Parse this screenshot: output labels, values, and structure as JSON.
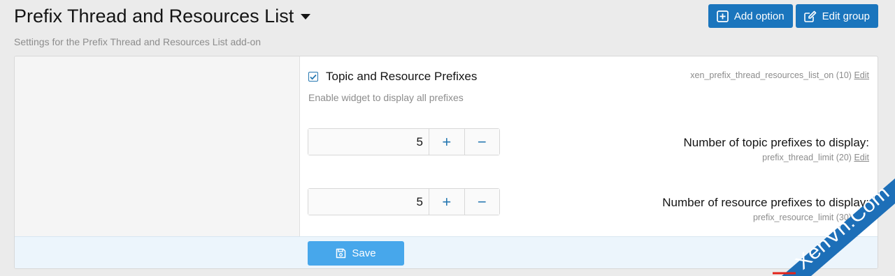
{
  "header": {
    "title": "Prefix Thread and Resources List",
    "description": "Settings for the Prefix Thread and Resources List add-on",
    "add_option_label": "Add option",
    "edit_group_label": "Edit group"
  },
  "options": {
    "toggle": {
      "code": "xen_prefix_thread_resources_list_on (10)",
      "edit_label": "Edit",
      "checkbox_label": "Topic and Resource Prefixes",
      "checked": true,
      "hint": "Enable widget to display all prefixes"
    },
    "thread_limit": {
      "label": "Number of topic prefixes to display:",
      "code": "prefix_thread_limit (20)",
      "edit_label": "Edit",
      "value": "5"
    },
    "resource_limit": {
      "label": "Number of resource prefixes to display:",
      "code": "prefix_resource_limit (30)",
      "edit_label": "Edit",
      "value": "5"
    }
  },
  "stepper": {
    "plus": "+",
    "minus": "−"
  },
  "submit": {
    "save_label": "Save"
  },
  "watermark": {
    "text": "XenVn.Com"
  },
  "colors": {
    "primary": "#1a75bd",
    "save": "#47a7eb",
    "accent": "#2577b1",
    "watermark": "#1d6fb8",
    "watermark_accent": "#e2231a"
  },
  "icons": {
    "title_caret": "caret-down-icon",
    "add_option": "plus-square-icon",
    "edit_group": "edit-icon",
    "checkbox": "check-icon",
    "save": "save-icon"
  }
}
